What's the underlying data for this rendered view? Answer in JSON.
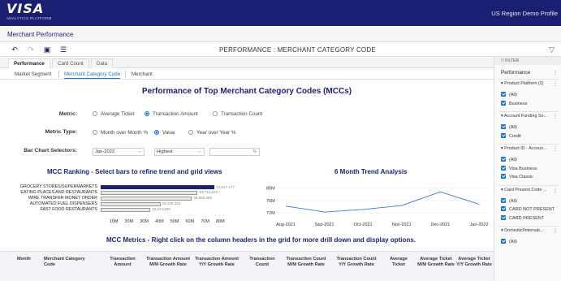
{
  "header": {
    "logo": "VISA",
    "logo_sub": "ANALYTICS PLATFORM",
    "profile": "US Region Demo Profile"
  },
  "subheader": {
    "title": "Merchant Performance"
  },
  "toolbar": {
    "title": "PERFORMANCE : MERCHANT CATEGORY CODE",
    "icons": [
      "undo-icon",
      "redo-icon",
      "save-icon",
      "details-icon"
    ],
    "filter_icon": "funnel-icon"
  },
  "tabs": [
    "Performance",
    "Card Count",
    "Data"
  ],
  "subtabs": [
    "Market Segment",
    "Merchant Category Code",
    "Merchant"
  ],
  "main": {
    "title": "Performance of Top Merchant Category Codes (MCCs)",
    "metric": {
      "label": "Metric:",
      "options": [
        "Average Ticket",
        "Transaction Amount",
        "Transaction Count"
      ],
      "selected": "Transaction Amount"
    },
    "metric_type": {
      "label": "Metric Type:",
      "options": [
        "Month over Month %",
        "Value",
        "Year over Year %"
      ],
      "selected": "Value"
    },
    "bar_selectors": {
      "label": "Bar Chart Selectors:",
      "month": "Jan-2022",
      "rank": "Highest",
      "pct_suffix": "%"
    }
  },
  "chart_data": [
    {
      "type": "bar",
      "title": "MCC Ranking - Select bars to refine trend and grid views",
      "categories": [
        "GROCERY STORES/SUPERMARKETS",
        "EATING PLACES AND RESTAURANTS",
        "WIRE TRANSFER MONEY ORDER",
        "AUTOMATED FUEL DISPENSERS",
        "FAST FOOD RESTAURANTS"
      ],
      "values": [
        74817177,
        63714513,
        59958386,
        39338331,
        32674809
      ],
      "value_labels": [
        "74,817,177",
        "63,714,513",
        "59,958,386",
        "39,338,331",
        "32,674,809"
      ],
      "xticks": [
        "10M",
        "20M",
        "30M",
        "40M",
        "50M",
        "60M",
        "70M",
        "80M"
      ],
      "xlim": [
        0,
        80000000
      ],
      "selected": [
        0
      ]
    },
    {
      "type": "line",
      "title": "6 Month Trend Analysis",
      "categories": [
        "Aug-2021",
        "Sep-2021",
        "Oct-2021",
        "Nov-2021",
        "Dec-2021",
        "Jan-2022"
      ],
      "values": [
        74.2,
        72.3,
        73.1,
        74.4,
        78.8,
        74.8
      ],
      "yticks": [
        "72M",
        "76M",
        "80M"
      ],
      "ylim": [
        71,
        82
      ],
      "color": "#4a6fd8"
    }
  ],
  "grid": {
    "title": "MCC Metrics - Right click on the column headers in the grid for more drill down and display options.",
    "headers": [
      "Month",
      "Merchant Category Code",
      "Transaction Amount",
      "Transaction Amount M/M Growth Rate",
      "Transaction Amount Y/Y Growth Rate",
      "Transaction Count",
      "Transaction Count M/M Growth Rate",
      "Transaction Count Y/Y Growth Rate",
      "Average Ticket",
      "Average Ticket M/M Growth Rate",
      "Average Ticket Y/Y Growth Rate"
    ]
  },
  "sidebar": {
    "head": "FILTER",
    "title": "Performance",
    "sections": [
      {
        "label": "Product Platform (2)",
        "items": [
          "(All)",
          "Business"
        ]
      },
      {
        "label": "Account Funding So...",
        "items": [
          "(All)",
          "Credit"
        ]
      },
      {
        "label": "Product ID - Accoun...",
        "items": [
          "(All)",
          "Visa Business",
          "Visa Classic"
        ]
      },
      {
        "label": "Card Present Code ...",
        "items": [
          "(All)",
          "CARD NOT PRESENT",
          "CARD PRESENT"
        ]
      },
      {
        "label": "Domestic/Internati...",
        "items": [
          "(All)"
        ]
      }
    ]
  }
}
